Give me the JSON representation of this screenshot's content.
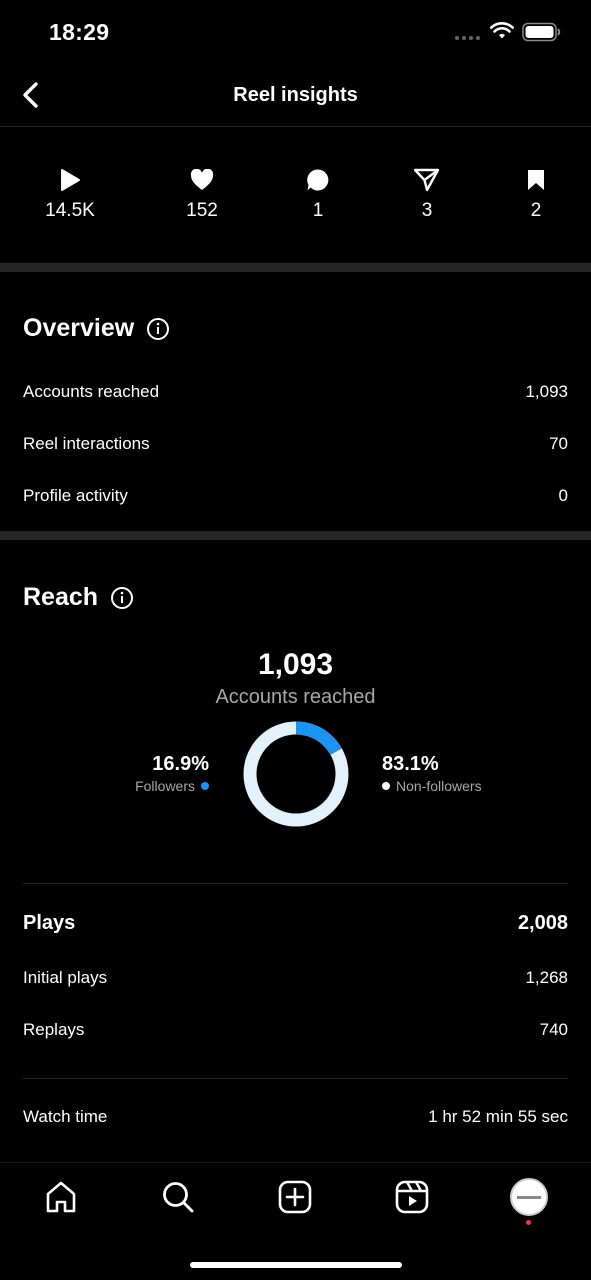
{
  "status_bar": {
    "time": "18:29"
  },
  "header": {
    "title": "Reel insights"
  },
  "stats": {
    "plays": "14.5K",
    "likes": "152",
    "comments": "1",
    "shares": "3",
    "saves": "2"
  },
  "overview": {
    "title": "Overview",
    "rows": [
      {
        "label": "Accounts reached",
        "value": "1,093"
      },
      {
        "label": "Reel interactions",
        "value": "70"
      },
      {
        "label": "Profile activity",
        "value": "0"
      }
    ]
  },
  "reach": {
    "title": "Reach",
    "total": "1,093",
    "caption": "Accounts reached",
    "followers_pct": "16.9%",
    "followers_label": "Followers",
    "followers_fraction": 0.169,
    "nonfollowers_pct": "83.1%",
    "nonfollowers_label": "Non-followers",
    "colors": {
      "followers": "#1c93f0",
      "nonfollowers": "#e3f1fc"
    }
  },
  "plays": {
    "title": "Plays",
    "total": "2,008",
    "rows": [
      {
        "label": "Initial plays",
        "value": "1,268"
      },
      {
        "label": "Replays",
        "value": "740"
      }
    ]
  },
  "watch_time": {
    "label": "Watch time",
    "value": "1 hr 52 min 55 sec"
  },
  "tab_bar": {
    "icons": [
      "home-icon",
      "search-icon",
      "create-icon",
      "reels-icon",
      "profile-avatar"
    ]
  }
}
